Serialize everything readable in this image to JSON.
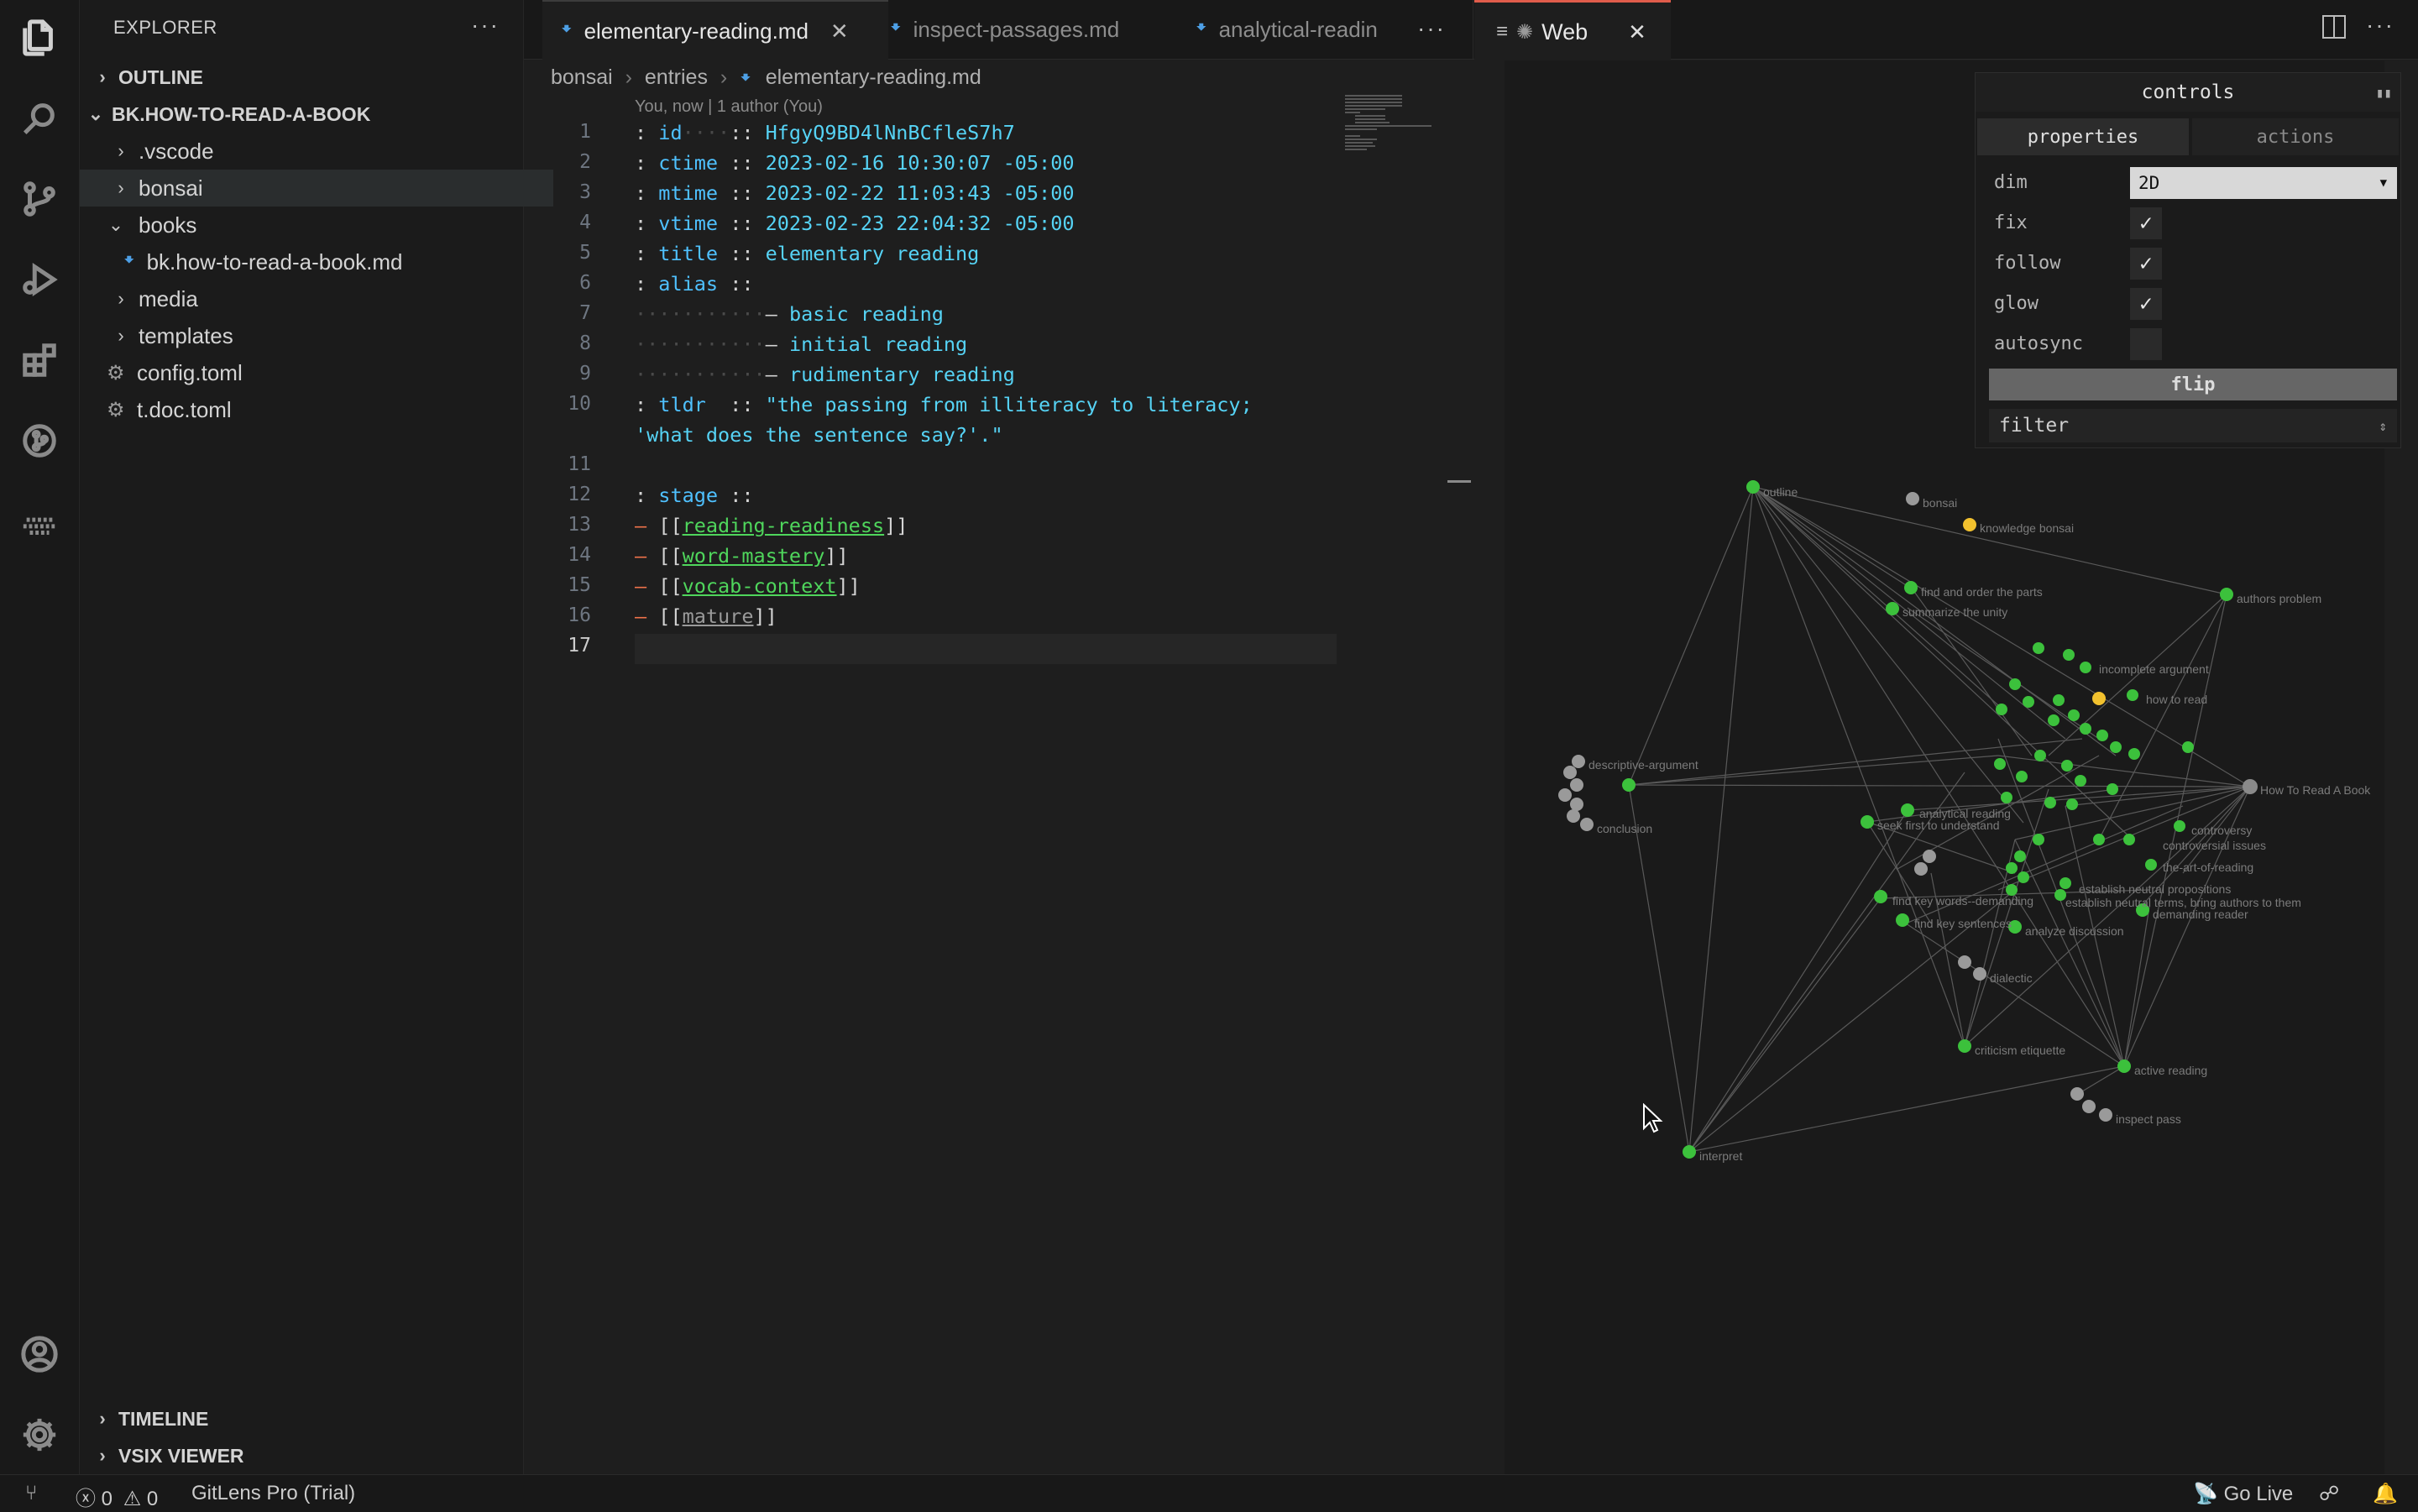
{
  "sidebar": {
    "title": "EXPLORER",
    "outline_label": "OUTLINE",
    "project_label": "BK.HOW-TO-READ-A-BOOK",
    "items": [
      {
        "label": ".vscode"
      },
      {
        "label": "bonsai"
      },
      {
        "label": "books"
      },
      {
        "label": "bk.how-to-read-a-book.md"
      },
      {
        "label": "media"
      },
      {
        "label": "templates"
      },
      {
        "label": "config.toml"
      },
      {
        "label": "t.doc.toml"
      }
    ],
    "timeline_label": "TIMELINE",
    "vsix_label": "VSIX VIEWER"
  },
  "tabs": [
    {
      "label": "elementary-reading.md"
    },
    {
      "label": "inspect-passages.md"
    },
    {
      "label": "analytical-readin"
    }
  ],
  "breadcrumb": [
    "bonsai",
    "entries",
    "elementary-reading.md"
  ],
  "blame": "You, now | 1 author (You)",
  "code": {
    "l1": {
      "key": "id",
      "value": "HfgyQ9BD4lNnBCfleS7h7"
    },
    "l2": {
      "key": "ctime",
      "value": "2023-02-16 10:30:07 -05:00"
    },
    "l3": {
      "key": "mtime",
      "value": "2023-02-22 11:03:43 -05:00"
    },
    "l4": {
      "key": "vtime",
      "value": "2023-02-23 22:04:32 -05:00"
    },
    "l5": {
      "key": "title",
      "value": "elementary reading"
    },
    "l6": {
      "key": "alias"
    },
    "aliases": [
      "basic reading",
      "initial reading",
      "rudimentary reading"
    ],
    "tldr_key": "tldr",
    "tldr_1": "\"the passing from illiteracy to literacy;",
    "tldr_2": "'what does the sentence say?'.\"",
    "stage_key": "stage",
    "links": [
      "reading-readiness",
      "word-mastery",
      "vocab-context",
      "mature"
    ],
    "line_numbers": [
      "1",
      "2",
      "3",
      "4",
      "5",
      "6",
      "7",
      "8",
      "9",
      "10",
      "",
      "11",
      "12",
      "13",
      "14",
      "15",
      "16",
      "17"
    ]
  },
  "web": {
    "tab_label": "Web",
    "controls": {
      "title": "controls",
      "tab_properties": "properties",
      "tab_actions": "actions",
      "dim_label": "dim",
      "dim_value": "2D",
      "fix_label": "fix",
      "follow_label": "follow",
      "glow_label": "glow",
      "autosync_label": "autosync",
      "fix_checked": true,
      "follow_checked": true,
      "glow_checked": true,
      "autosync_checked": false,
      "flip_label": "flip",
      "filter_label": "filter"
    },
    "graph_labels": {
      "outline": "outline",
      "bonsai": "bonsai",
      "knowledge_bonsai": "knowledge bonsai",
      "find_order": "find and order the parts",
      "summarize": "summarize the unity",
      "authors_problem": "authors problem",
      "incomplete_argument": "incomplete argument",
      "how_to_read": "how to read",
      "how_to_read_a_book": "How To Read A Book",
      "descriptive_argument": "descriptive-argument",
      "conclusion": "conclusion",
      "analytical_reading": "analytical reading",
      "seek_first": "seek first to understand",
      "controversy": "controversy",
      "controversial_issues": "controversial issues",
      "the_art_of_reading": "the-art-of-reading",
      "establish_neutral": "establish neutral propositions",
      "key_words": "find key words--demanding",
      "establish_neutral_terms": "establish neutral terms, bring authors to them",
      "demanding_reader": "demanding reader",
      "find_key_sentences": "find key sentences",
      "analyze_discussion": "analyze discussion",
      "dialectic": "dialectic",
      "criticism_etiquette": "criticism etiquette",
      "active_reading": "active reading",
      "inspect_pass": "inspect pass",
      "interpret": "interpret"
    }
  },
  "status": {
    "errors": "0",
    "warnings": "0",
    "gitlens": "GitLens Pro (Trial)",
    "golive": "Go Live"
  }
}
